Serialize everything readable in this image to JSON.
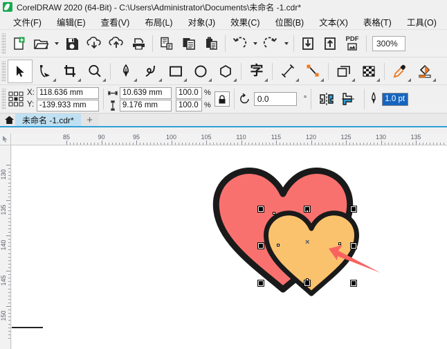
{
  "window": {
    "title": "CorelDRAW 2020 (64-Bit) - C:\\Users\\Administrator\\Documents\\未命名 -1.cdr*",
    "app_icon": "coreldraw-logo"
  },
  "menubar": {
    "items": [
      {
        "label": "文件(F)",
        "name": "menu-file"
      },
      {
        "label": "编辑(E)",
        "name": "menu-edit"
      },
      {
        "label": "查看(V)",
        "name": "menu-view"
      },
      {
        "label": "布局(L)",
        "name": "menu-layout"
      },
      {
        "label": "对象(J)",
        "name": "menu-object"
      },
      {
        "label": "效果(C)",
        "name": "menu-effects"
      },
      {
        "label": "位图(B)",
        "name": "menu-bitmap"
      },
      {
        "label": "文本(X)",
        "name": "menu-text"
      },
      {
        "label": "表格(T)",
        "name": "menu-table"
      },
      {
        "label": "工具(O)",
        "name": "menu-tools"
      }
    ]
  },
  "standard_toolbar": {
    "buttons": [
      {
        "name": "new-document-icon",
        "tip": "新建"
      },
      {
        "name": "open-document-icon",
        "tip": "打开"
      },
      {
        "name": "save-document-icon",
        "tip": "保存"
      },
      {
        "name": "cloud-download-icon",
        "tip": "导入"
      },
      {
        "name": "cloud-upload-icon",
        "tip": "导出"
      },
      {
        "name": "print-icon",
        "tip": "打印"
      },
      {
        "name": "cut-copy-icon",
        "tip": "剪切"
      },
      {
        "name": "copy-icon",
        "tip": "复制"
      },
      {
        "name": "paste-icon",
        "tip": "粘贴"
      },
      {
        "name": "undo-icon",
        "tip": "撤消"
      },
      {
        "name": "redo-icon",
        "tip": "重做"
      },
      {
        "name": "import-icon",
        "tip": "导入"
      },
      {
        "name": "export-icon",
        "tip": "导出"
      },
      {
        "name": "publish-pdf-icon",
        "tip": "PDF"
      }
    ],
    "pdf_label": "PDF",
    "zoom_level": "300%"
  },
  "tools_toolbar": {
    "tools": [
      {
        "name": "pick-tool-icon",
        "active": true
      },
      {
        "name": "shape-tool-icon",
        "active": false
      },
      {
        "name": "crop-tool-icon",
        "active": false
      },
      {
        "name": "zoom-tool-icon",
        "active": false
      },
      {
        "name": "pen-tool-icon",
        "active": false
      },
      {
        "name": "artistic-media-tool-icon",
        "active": false
      },
      {
        "name": "rectangle-tool-icon",
        "active": false
      },
      {
        "name": "ellipse-tool-icon",
        "active": false
      },
      {
        "name": "polygon-tool-icon",
        "active": false
      },
      {
        "name": "text-tool-icon",
        "active": false,
        "glyph": "字"
      },
      {
        "name": "dimension-tool-icon",
        "active": false
      },
      {
        "name": "connector-tool-icon",
        "active": false
      },
      {
        "name": "drop-shadow-tool-icon",
        "active": false
      },
      {
        "name": "transparency-tool-icon",
        "active": false
      },
      {
        "name": "color-eyedropper-tool-icon",
        "active": false
      },
      {
        "name": "interactive-fill-tool-icon",
        "active": false
      }
    ]
  },
  "property_bar": {
    "x_label": "X:",
    "y_label": "Y:",
    "x_value": "118.636 mm",
    "y_value": "-139.933 mm",
    "width_value": "10.639 mm",
    "height_value": "9.176 mm",
    "scale_x": "100.0",
    "scale_y": "100.0",
    "percent_symbol": "%",
    "lock_ratio_icon": "lock-icon",
    "rotation_value": "0.0",
    "rotation_unit": "°",
    "mirror_horizontal_icon": "mirror-horizontal-icon",
    "mirror_vertical_icon": "mirror-vertical-icon",
    "outline_width_icon": "outline-pen-icon",
    "outline_width_value": "1.0 pt"
  },
  "tabbar": {
    "home_icon": "home-icon",
    "document_tab": "未命名 -1.cdr*",
    "new_tab_label": "+"
  },
  "rulers": {
    "unit": "mm",
    "horizontal_labels": [
      "85",
      "90",
      "95",
      "100",
      "105",
      "110",
      "115",
      "120",
      "125",
      "130",
      "135"
    ],
    "vertical_labels": [
      "130",
      "135",
      "140",
      "145",
      "150"
    ]
  },
  "canvas": {
    "objects": [
      {
        "name": "large-heart",
        "fill_color": "#F9716E",
        "outline_color": "#1A1A1A",
        "selected": false
      },
      {
        "name": "small-heart",
        "fill_color": "#FBC26D",
        "outline_color": "#1A1A1A",
        "selected": true
      }
    ],
    "selection": {
      "center_marker": "×",
      "handle_color": "#000000",
      "node_color": "#FFFFFF"
    },
    "annotation": {
      "name": "red-arrow-annotation",
      "color": "#F9635F"
    }
  }
}
